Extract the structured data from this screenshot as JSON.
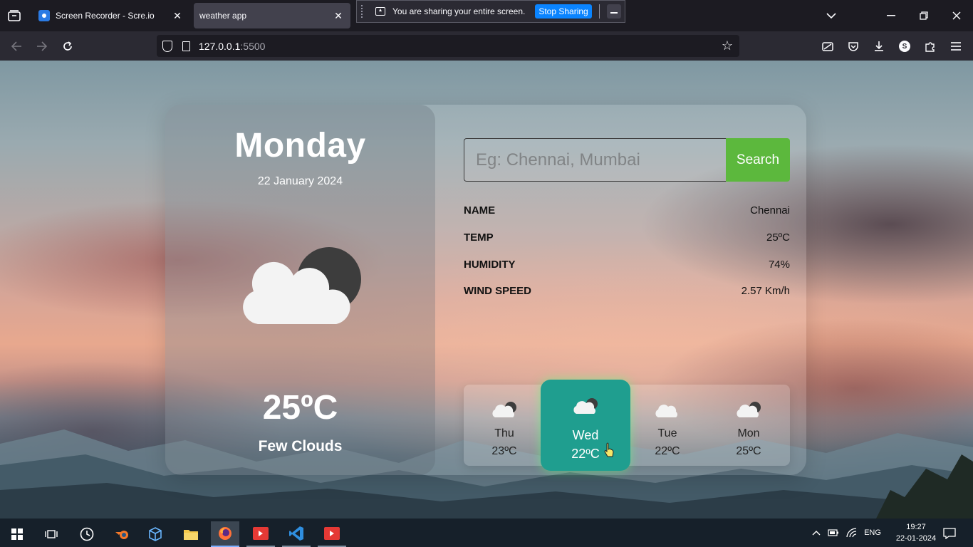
{
  "browser": {
    "tabs": [
      {
        "title": "Screen Recorder - Scre.io",
        "active": false
      },
      {
        "title": "weather app",
        "active": true
      }
    ],
    "share_bar": {
      "message": "You are sharing your entire screen.",
      "stop_label": "Stop Sharing"
    },
    "url_host": "127.0.0.1",
    "url_port": ":5500"
  },
  "app": {
    "day": "Monday",
    "date": "22 January 2024",
    "temperature": "25ºC",
    "description": "Few Clouds",
    "search_placeholder": "Eg: Chennai, Mumbai",
    "search_button": "Search",
    "stats": [
      {
        "label": "NAME",
        "value": "Chennai"
      },
      {
        "label": "TEMP",
        "value": "25ºC"
      },
      {
        "label": "HUMIDITY",
        "value": "74%"
      },
      {
        "label": "WIND SPEED",
        "value": "2.57 Km/h"
      }
    ],
    "forecast": [
      {
        "day": "Thu",
        "temp": "23ºC",
        "icon": "cloud-moon-icon"
      },
      {
        "day": "Wed",
        "temp": "22ºC",
        "icon": "cloud-moon-icon"
      },
      {
        "day": "Tue",
        "temp": "22ºC",
        "icon": "cloud-icon"
      },
      {
        "day": "Mon",
        "temp": "25ºC",
        "icon": "cloud-moon-icon"
      }
    ]
  },
  "taskbar": {
    "language": "ENG",
    "time": "19:27",
    "date": "22-01-2024"
  },
  "colors": {
    "search_button": "#5cb83d",
    "active_forecast": "#1f9e8f",
    "stop_sharing": "#0a84ff"
  }
}
